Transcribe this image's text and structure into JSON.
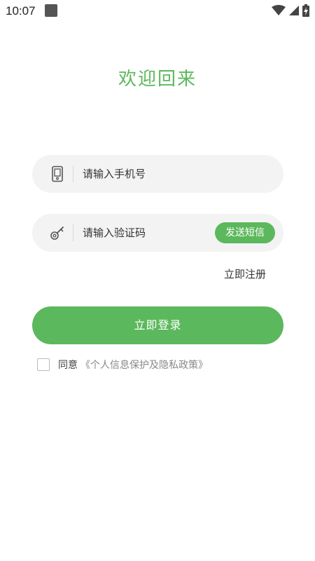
{
  "status_bar": {
    "time": "10:07"
  },
  "title": "欢迎回来",
  "phone_field": {
    "placeholder": "请输入手机号",
    "icon": "phone-icon"
  },
  "code_field": {
    "placeholder": "请输入验证码",
    "icon": "key-icon",
    "send_sms_label": "发送短信"
  },
  "register_label": "立即注册",
  "login_label": "立即登录",
  "agreement": {
    "agree_label": "同意",
    "policy_label": "《个人信息保护及隐私政策》",
    "checked": false
  },
  "colors": {
    "accent": "#5cb85c",
    "field_bg": "#f3f3f3"
  }
}
